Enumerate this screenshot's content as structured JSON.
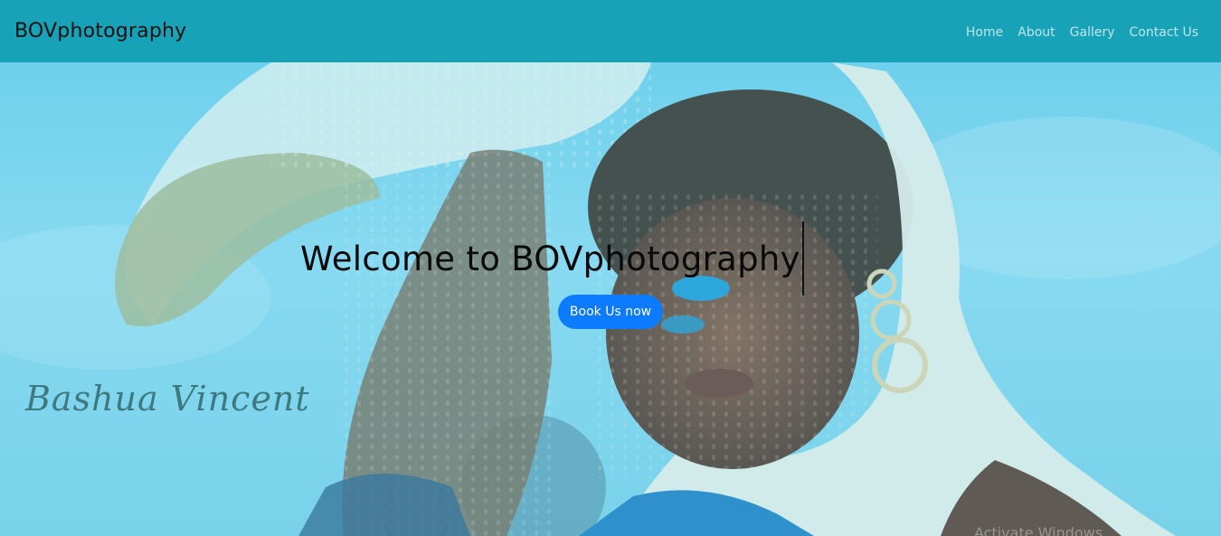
{
  "navbar": {
    "brand": "BOVphotography",
    "links": [
      "Home",
      "About",
      "Gallery",
      "Contact Us"
    ],
    "background": "#17a2b8"
  },
  "hero": {
    "heading": "Welcome to BOVphotography",
    "cta_label": "Book Us now",
    "cta_color": "#0d7bff",
    "signature": "Bashua Vincent",
    "overlay_tint": "#6fd0ec"
  },
  "system": {
    "watermark": "Activate Windows"
  }
}
